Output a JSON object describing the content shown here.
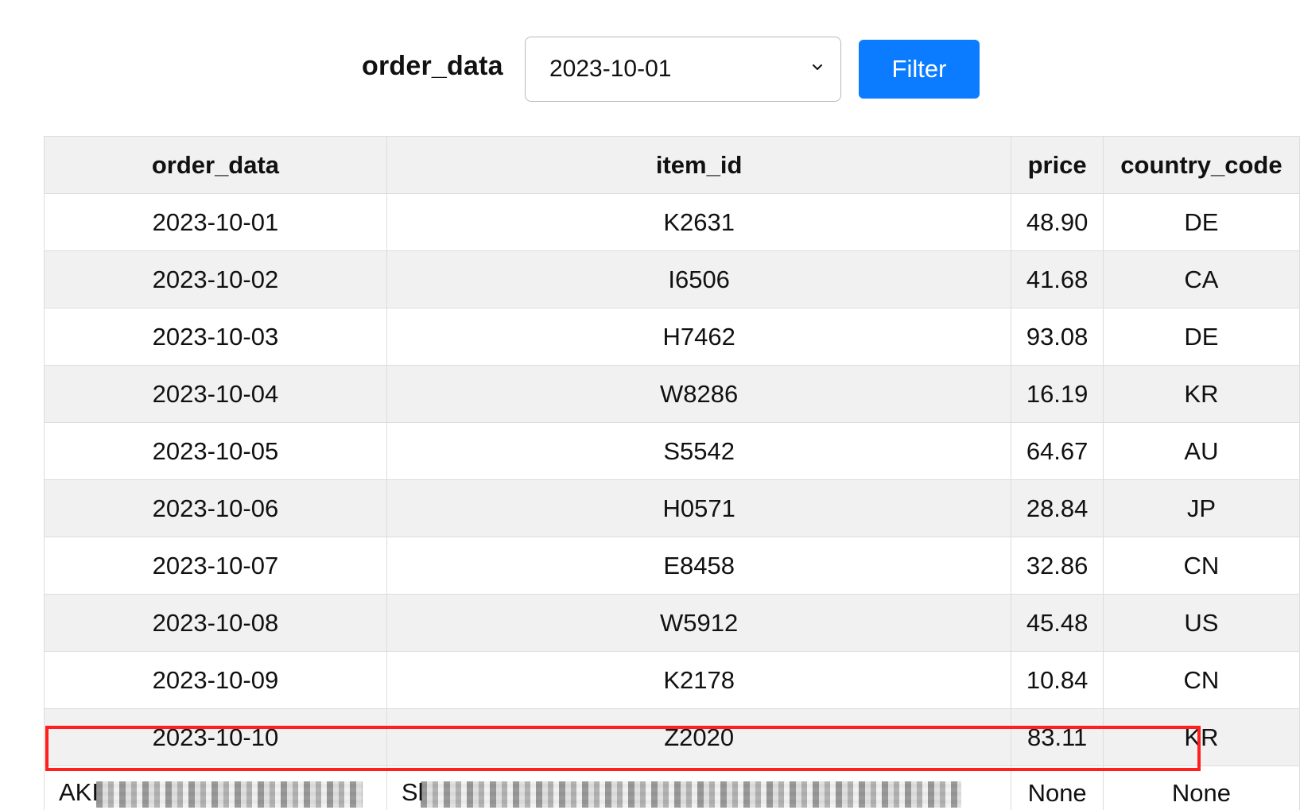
{
  "filter": {
    "label": "order_data",
    "selected_value": "2023-10-01",
    "button_label": "Filter",
    "chevron_icon": "chevron-down-icon",
    "button_color": "#0b7cff"
  },
  "table": {
    "headers": {
      "order_data": "order_data",
      "item_id": "item_id",
      "price": "price",
      "country_code": "country_code"
    },
    "rows": [
      {
        "order_data": "2023-10-01",
        "item_id": "K2631",
        "price": "48.90",
        "country_code": "DE"
      },
      {
        "order_data": "2023-10-02",
        "item_id": "I6506",
        "price": "41.68",
        "country_code": "CA"
      },
      {
        "order_data": "2023-10-03",
        "item_id": "H7462",
        "price": "93.08",
        "country_code": "DE"
      },
      {
        "order_data": "2023-10-04",
        "item_id": "W8286",
        "price": "16.19",
        "country_code": "KR"
      },
      {
        "order_data": "2023-10-05",
        "item_id": "S5542",
        "price": "64.67",
        "country_code": "AU"
      },
      {
        "order_data": "2023-10-06",
        "item_id": "H0571",
        "price": "28.84",
        "country_code": "JP"
      },
      {
        "order_data": "2023-10-07",
        "item_id": "E8458",
        "price": "32.86",
        "country_code": "CN"
      },
      {
        "order_data": "2023-10-08",
        "item_id": "W5912",
        "price": "45.48",
        "country_code": "US"
      },
      {
        "order_data": "2023-10-09",
        "item_id": "K2178",
        "price": "10.84",
        "country_code": "CN"
      },
      {
        "order_data": "2023-10-10",
        "item_id": "Z2020",
        "price": "83.11",
        "country_code": "KR"
      }
    ],
    "sensitive_row": {
      "order_data_prefix": "AKI",
      "item_id_prefix": "Sl",
      "price": "None",
      "country_code": "None",
      "highlight_color": "#ff1f1f"
    }
  }
}
